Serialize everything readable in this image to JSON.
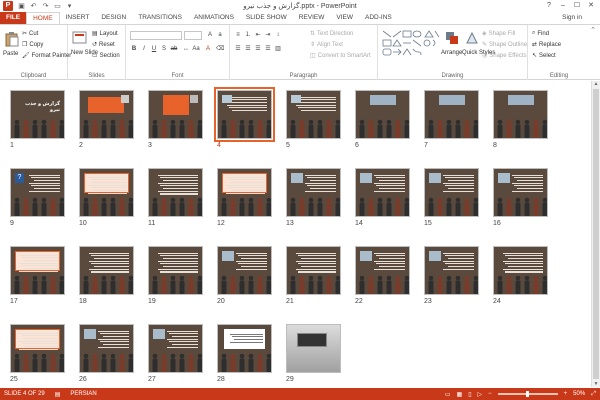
{
  "window": {
    "title": "گزارش و جذب نیرو.pptx - PowerPoint",
    "controls": [
      "?",
      "–",
      "☐",
      "✕"
    ]
  },
  "tabs": [
    {
      "label": "FILE",
      "kind": "file"
    },
    {
      "label": "HOME",
      "kind": "active"
    },
    {
      "label": "INSERT"
    },
    {
      "label": "DESIGN"
    },
    {
      "label": "TRANSITIONS"
    },
    {
      "label": "ANIMATIONS"
    },
    {
      "label": "SLIDE SHOW"
    },
    {
      "label": "REVIEW"
    },
    {
      "label": "VIEW"
    },
    {
      "label": "ADD-INS"
    }
  ],
  "signin": "Sign in",
  "ribbon": {
    "clipboard": {
      "label": "Clipboard",
      "paste": "Paste",
      "cut": "Cut",
      "copy": "Copy",
      "format_painter": "Format Painter"
    },
    "slides": {
      "label": "Slides",
      "new_slide": "New Slide",
      "layout": "Layout",
      "reset": "Reset",
      "section": "Section"
    },
    "font": {
      "label": "Font"
    },
    "paragraph": {
      "label": "Paragraph",
      "text_direction": "Text Direction",
      "align_text": "Align Text",
      "convert_smartart": "Convert to SmartArt"
    },
    "drawing": {
      "label": "Drawing",
      "arrange": "Arrange",
      "quick_styles": "Quick Styles",
      "shape_fill": "Shape Fill",
      "shape_outline": "Shape Outline",
      "shape_effects": "Shape Effects"
    },
    "editing": {
      "label": "Editing",
      "find": "Find",
      "replace": "Replace",
      "select": "Select"
    }
  },
  "slides": [
    {
      "n": "1",
      "kind": "title",
      "text": "گزارش و جذب نیرو"
    },
    {
      "n": "2",
      "kind": "orange-box"
    },
    {
      "n": "3",
      "kind": "orange-center"
    },
    {
      "n": "4",
      "kind": "text-photo",
      "selected": true
    },
    {
      "n": "5",
      "kind": "text-photo"
    },
    {
      "n": "6",
      "kind": "photo-top"
    },
    {
      "n": "7",
      "kind": "photo-top"
    },
    {
      "n": "8",
      "kind": "photo-top"
    },
    {
      "n": "9",
      "kind": "question"
    },
    {
      "n": "10",
      "kind": "table"
    },
    {
      "n": "11",
      "kind": "text"
    },
    {
      "n": "12",
      "kind": "table"
    },
    {
      "n": "13",
      "kind": "photo-text"
    },
    {
      "n": "14",
      "kind": "photo-text"
    },
    {
      "n": "15",
      "kind": "photo-text"
    },
    {
      "n": "16",
      "kind": "photo-text"
    },
    {
      "n": "17",
      "kind": "table"
    },
    {
      "n": "18",
      "kind": "text"
    },
    {
      "n": "19",
      "kind": "text"
    },
    {
      "n": "20",
      "kind": "photo-text"
    },
    {
      "n": "21",
      "kind": "text"
    },
    {
      "n": "22",
      "kind": "photo-text"
    },
    {
      "n": "23",
      "kind": "photo-text"
    },
    {
      "n": "24",
      "kind": "text"
    },
    {
      "n": "25",
      "kind": "table"
    },
    {
      "n": "26",
      "kind": "photo-text"
    },
    {
      "n": "27",
      "kind": "photo-text"
    },
    {
      "n": "28",
      "kind": "white-box"
    },
    {
      "n": "29",
      "kind": "laptop"
    }
  ],
  "status": {
    "slide_indicator": "SLIDE 4 OF 29",
    "language": "PERSIAN",
    "zoom": "50%",
    "zoom_fraction": 0.5
  },
  "colors": {
    "accent": "#c8391a",
    "slide_bg": "#5a4a3e",
    "slide_orange": "#e8632c",
    "people": "#2e2e2e"
  }
}
